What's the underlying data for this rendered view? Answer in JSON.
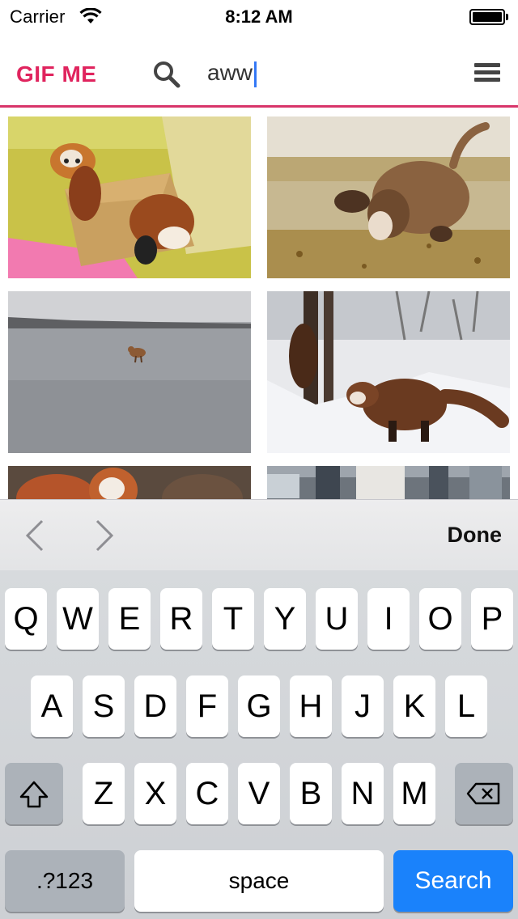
{
  "status_bar": {
    "carrier": "Carrier",
    "time": "8:12 AM"
  },
  "header": {
    "brand": "GIF ME",
    "search_value": "aww",
    "search_icon": "search-icon",
    "menu_icon": "hamburger-menu-icon",
    "brand_color": "#e0245e"
  },
  "gifs": [
    {
      "description": "red pandas in a cardboard box"
    },
    {
      "description": "basset hound running in a field"
    },
    {
      "description": "fox on a frozen lake"
    },
    {
      "description": "red panda in the snow by a tree"
    },
    {
      "description": "red panda"
    },
    {
      "description": "animal at a fence"
    }
  ],
  "accessory": {
    "prev_icon": "chevron-left-icon",
    "next_icon": "chevron-right-icon",
    "done_label": "Done"
  },
  "keyboard": {
    "row1": [
      "Q",
      "W",
      "E",
      "R",
      "T",
      "Y",
      "U",
      "I",
      "O",
      "P"
    ],
    "row2": [
      "A",
      "S",
      "D",
      "F",
      "G",
      "H",
      "J",
      "K",
      "L"
    ],
    "row3": [
      "Z",
      "X",
      "C",
      "V",
      "B",
      "N",
      "M"
    ],
    "shift_icon": "shift-icon",
    "delete_icon": "delete-backspace-icon",
    "numbers_label": ".?123",
    "space_label": "space",
    "search_label": "Search",
    "search_key_color": "#1a82fb"
  }
}
